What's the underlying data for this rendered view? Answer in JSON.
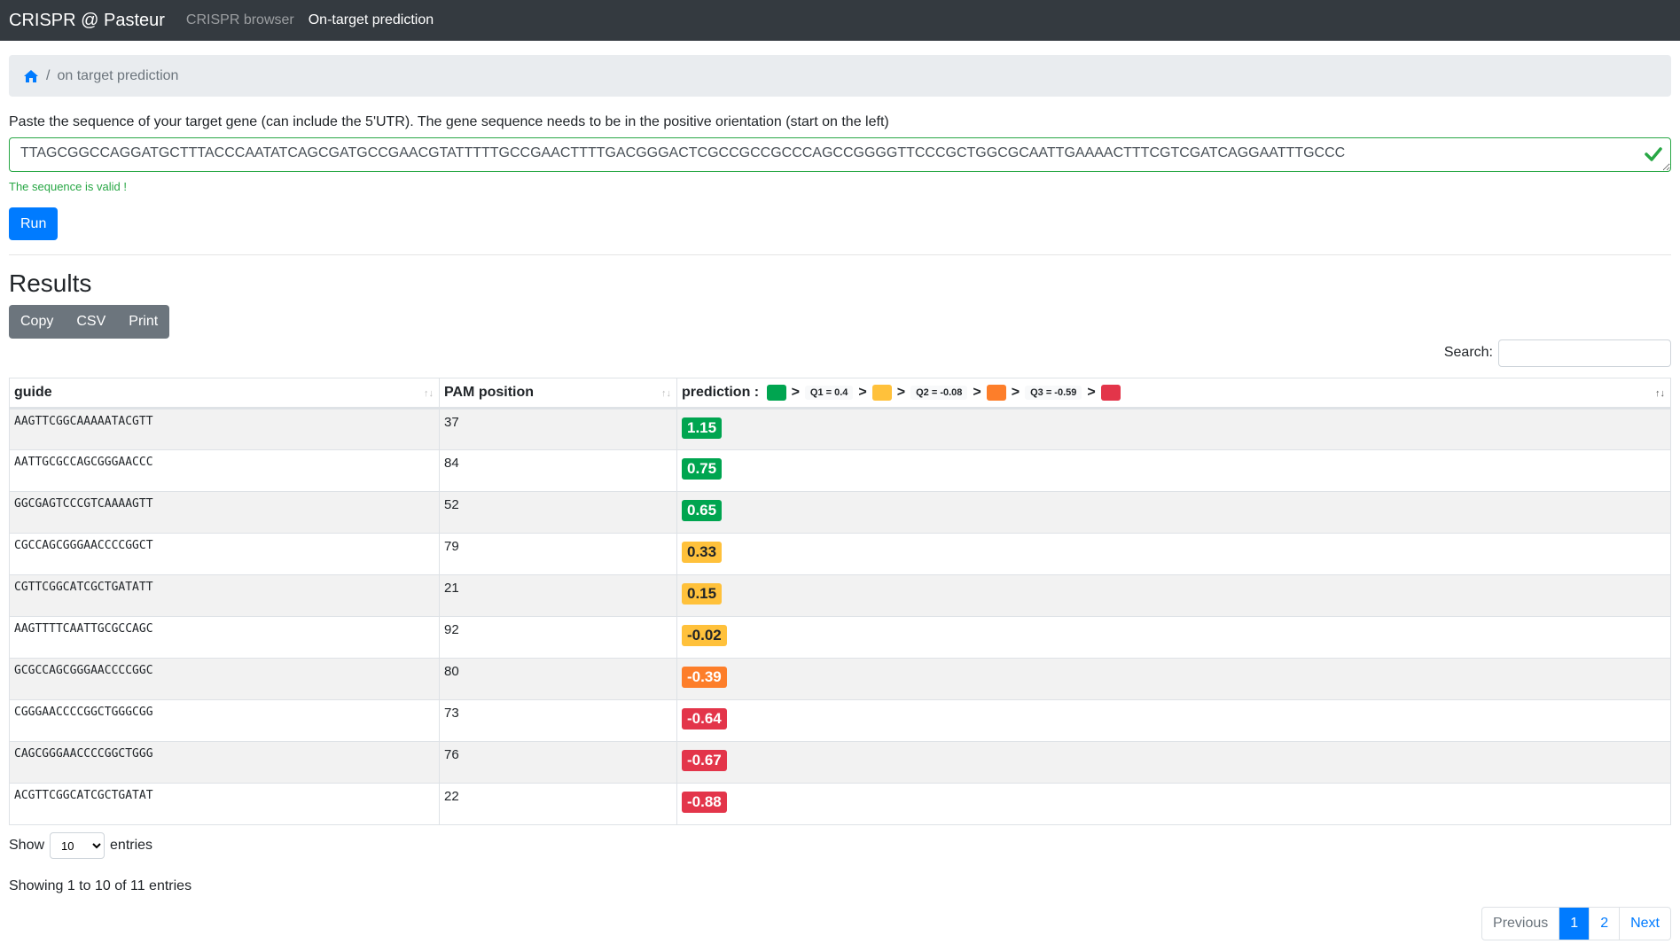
{
  "navbar": {
    "brand": "CRISPR @ Pasteur",
    "links": [
      {
        "label": "CRISPR browser",
        "active": false
      },
      {
        "label": "On-target prediction",
        "active": true
      }
    ]
  },
  "breadcrumb": {
    "home_icon": "home-icon",
    "separator": "/",
    "current": "on target prediction"
  },
  "form": {
    "label": "Paste the sequence of your target gene (can include the 5'UTR). The gene sequence needs to be in the positive orientation (start on the left)",
    "sequence": "TTAGCGGCCAGGATGCTTTACCCAATATCAGCGATGCCGAACGTATTTTTGCCGAACTTTTGACGGGACTCGCCGCCGCCCAGCCGGGGTTCCCGCTGGCGCAATTGAAAACTTTCGTCGATCAGGAATTTGCCC",
    "valid_icon": "check-icon",
    "valid_message": "The sequence is valid !",
    "run_label": "Run"
  },
  "results": {
    "title": "Results",
    "export_buttons": [
      "Copy",
      "CSV",
      "Print"
    ],
    "search_label": "Search:",
    "search_value": "",
    "columns": {
      "guide": "guide",
      "pam": "PAM position",
      "prediction": "prediction :"
    },
    "legend": {
      "colors": {
        "green": "#00a550",
        "yellow": "#ffc13b",
        "orange": "#fd7e2a",
        "red": "#e3354a"
      },
      "gt": ">",
      "q1": "Q1 = 0.4",
      "q2": "Q2 = -0.08",
      "q3": "Q3 = -0.59"
    },
    "rows": [
      {
        "guide": "AAGTTCGGCAAAAATACGTT",
        "pam": "37",
        "prediction": "1.15",
        "level": "green"
      },
      {
        "guide": "AATTGCGCCAGCGGGAACCC",
        "pam": "84",
        "prediction": "0.75",
        "level": "green"
      },
      {
        "guide": "GGCGAGTCCCGTCAAAAGTT",
        "pam": "52",
        "prediction": "0.65",
        "level": "green"
      },
      {
        "guide": "CGCCAGCGGGAACCCCGGCT",
        "pam": "79",
        "prediction": "0.33",
        "level": "yellow"
      },
      {
        "guide": "CGTTCGGCATCGCTGATATT",
        "pam": "21",
        "prediction": "0.15",
        "level": "yellow"
      },
      {
        "guide": "AAGTTTTCAATTGCGCCAGC",
        "pam": "92",
        "prediction": "-0.02",
        "level": "yellow"
      },
      {
        "guide": "GCGCCAGCGGGAACCCCGGC",
        "pam": "80",
        "prediction": "-0.39",
        "level": "orange"
      },
      {
        "guide": "CGGGAACCCCGGCTGGGCGG",
        "pam": "73",
        "prediction": "-0.64",
        "level": "red"
      },
      {
        "guide": "CAGCGGGAACCCCGGCTGGG",
        "pam": "76",
        "prediction": "-0.67",
        "level": "red"
      },
      {
        "guide": "ACGTTCGGCATCGCTGATAT",
        "pam": "22",
        "prediction": "-0.88",
        "level": "red"
      }
    ],
    "length": {
      "prefix": "Show",
      "value": "10",
      "suffix": "entries"
    },
    "info": "Showing 1 to 10 of 11 entries",
    "pagination": {
      "previous": "Previous",
      "pages": [
        "1",
        "2"
      ],
      "current": "1",
      "next": "Next"
    }
  }
}
